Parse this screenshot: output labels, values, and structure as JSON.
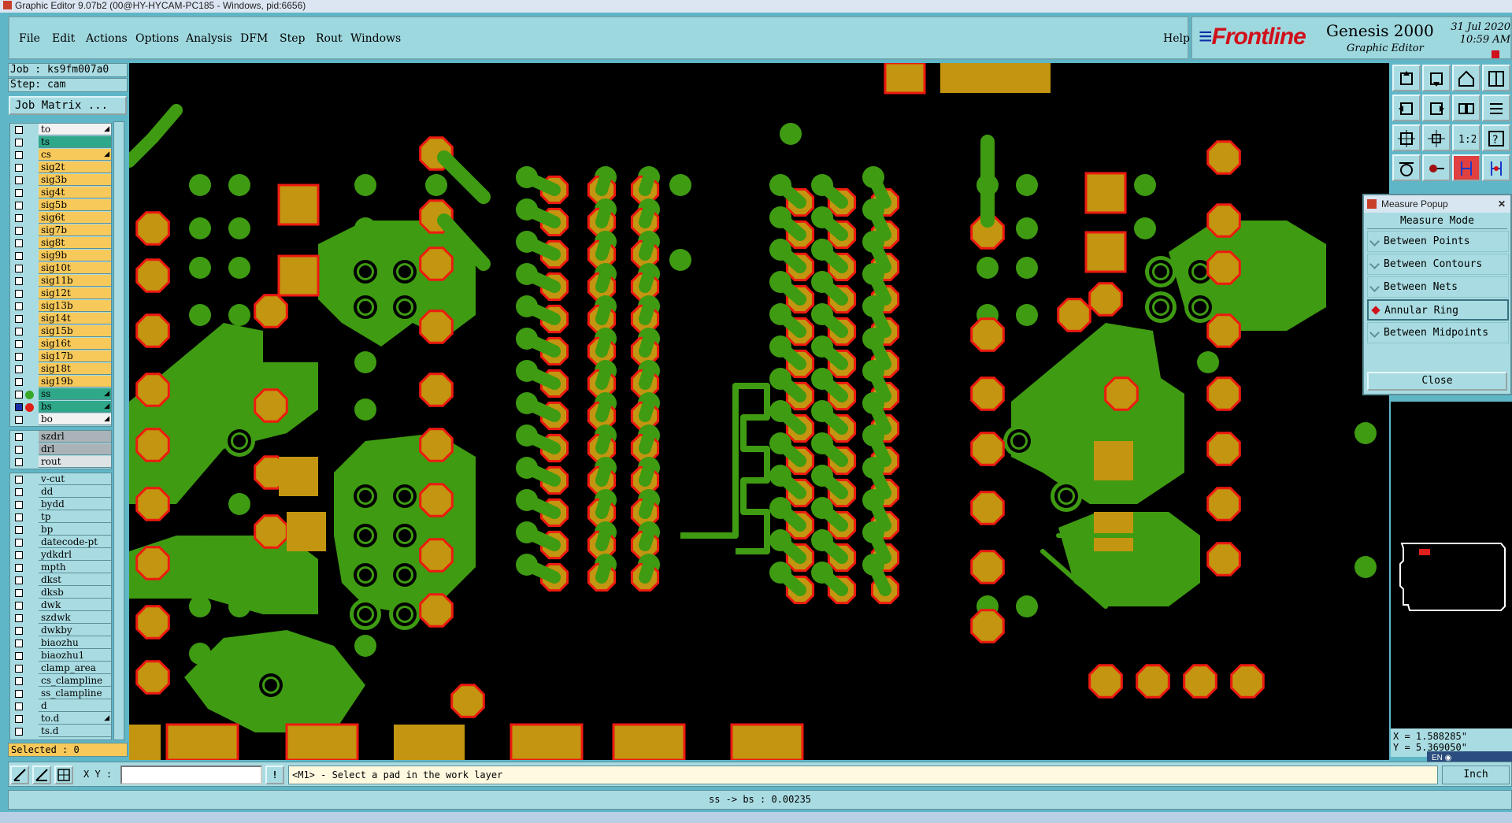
{
  "window": {
    "title": "Graphic Editor 9.07b2 (00@HY-HYCAM-PC185 - Windows, pid:6656)"
  },
  "menu": {
    "items": [
      "File",
      "Edit",
      "Actions",
      "Options",
      "Analysis",
      "DFM",
      "Step",
      "Rout",
      "Windows"
    ],
    "help": "Help"
  },
  "brand": {
    "logo_red": "Frontline",
    "product": "Genesis 2000",
    "subtitle": "Graphic Editor",
    "date": "31 Jul 2020",
    "time": "10:59 AM"
  },
  "job": {
    "job_label": "Job : ks9fm007a0",
    "step_label": "Step: cam",
    "matrix_button": "Job Matrix ..."
  },
  "layers_main": [
    {
      "name": "to",
      "color": "#f2f2f2",
      "arrow": true
    },
    {
      "name": "ts",
      "color": "#2fa88a"
    },
    {
      "name": "cs",
      "color": "#f7c95a",
      "arrow": true
    },
    {
      "name": "sig2t",
      "color": "#f7c95a"
    },
    {
      "name": "sig3b",
      "color": "#f7c95a"
    },
    {
      "name": "sig4t",
      "color": "#f7c95a"
    },
    {
      "name": "sig5b",
      "color": "#f7c95a"
    },
    {
      "name": "sig6t",
      "color": "#f7c95a"
    },
    {
      "name": "sig7b",
      "color": "#f7c95a"
    },
    {
      "name": "sig8t",
      "color": "#f7c95a"
    },
    {
      "name": "sig9b",
      "color": "#f7c95a"
    },
    {
      "name": "sig10t",
      "color": "#f7c95a"
    },
    {
      "name": "sig11b",
      "color": "#f7c95a"
    },
    {
      "name": "sig12t",
      "color": "#f7c95a"
    },
    {
      "name": "sig13b",
      "color": "#f7c95a"
    },
    {
      "name": "sig14t",
      "color": "#f7c95a"
    },
    {
      "name": "sig15b",
      "color": "#f7c95a"
    },
    {
      "name": "sig16t",
      "color": "#f7c95a"
    },
    {
      "name": "sig17b",
      "color": "#f7c95a"
    },
    {
      "name": "sig18t",
      "color": "#f7c95a"
    },
    {
      "name": "sig19b",
      "color": "#f7c95a"
    },
    {
      "name": "ss",
      "color": "#2fa88a",
      "arrow": true,
      "dot": "#37a82a"
    },
    {
      "name": "bs",
      "color": "#2fa88a",
      "arrow": true,
      "dot": "#e0201a",
      "work": true
    },
    {
      "name": "bo",
      "color": "#f2f2f2",
      "arrow": true
    }
  ],
  "layers_drill": [
    {
      "name": "szdrl",
      "color": "#aab4b8"
    },
    {
      "name": "drl",
      "color": "#aab4b8"
    },
    {
      "name": "rout",
      "color": "#dde4e6"
    }
  ],
  "layers_misc": [
    {
      "name": "v-cut"
    },
    {
      "name": "dd"
    },
    {
      "name": "bydd"
    },
    {
      "name": "tp"
    },
    {
      "name": "bp"
    },
    {
      "name": "datecode-pt"
    },
    {
      "name": "ydkdrl"
    },
    {
      "name": "mpth"
    },
    {
      "name": "dkst"
    },
    {
      "name": "dksb"
    },
    {
      "name": "dwk"
    },
    {
      "name": "szdwk"
    },
    {
      "name": "dwkby"
    },
    {
      "name": "biaozhu"
    },
    {
      "name": "biaozhu1"
    },
    {
      "name": "clamp_area"
    },
    {
      "name": "cs_clampline"
    },
    {
      "name": "ss_clampline"
    },
    {
      "name": "d"
    },
    {
      "name": "to.d",
      "arrow": true
    },
    {
      "name": "ts.d"
    }
  ],
  "selected": "Selected : 0",
  "measure": {
    "title": "Measure Popup",
    "header": "Measure Mode",
    "options": [
      "Between Points",
      "Between Contours",
      "Between Nets",
      "Annular Ring",
      "Between Midpoints"
    ],
    "selected_option": "Annular Ring",
    "close": "Close"
  },
  "coords": {
    "x": "X = 1.588285\"",
    "y": "Y = 5.369050\""
  },
  "bottom": {
    "xy_label": "X Y :",
    "xy_value": "",
    "excl": "!",
    "prompt": "<M1> - Select a pad in the work layer",
    "units": "Inch"
  },
  "status": "ss -> bs : 0.00235",
  "tray": "EN",
  "colors": {
    "copper": "#3f9b12",
    "pad": "#c39510",
    "ring": "#ee1a10",
    "bg": "#000000",
    "panel": "#a9dce2"
  }
}
